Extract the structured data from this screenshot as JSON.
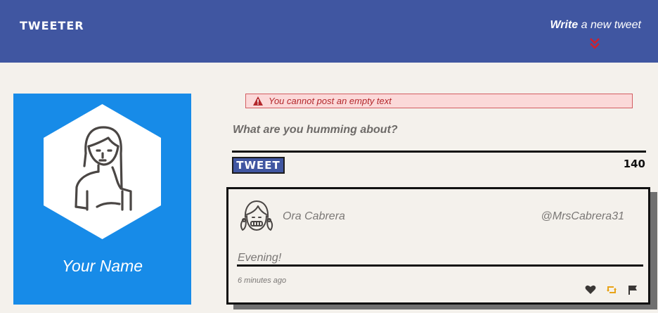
{
  "header": {
    "logo": "TWEETER",
    "compose_toggle_bold": "Write",
    "compose_toggle_rest": " a new tweet",
    "background_color": "#4056a1"
  },
  "profile": {
    "name": "Your Name",
    "background_color": "#178be8",
    "avatar_icon": "user-avatar-icon"
  },
  "compose": {
    "error_message": "You cannot post an empty text",
    "error_icon": "warning-triangle-icon",
    "placeholder": "What are you humming about?",
    "value": "",
    "submit_label": "TWEET",
    "char_count": "140"
  },
  "tweets": [
    {
      "author": "Ora Cabrera",
      "handle": "@MrsCabrera31",
      "text": "Evening!",
      "timestamp": "6 minutes ago",
      "actions": [
        "heart-icon",
        "retweet-icon",
        "flag-icon"
      ],
      "retweet_color": "#e8a317"
    }
  ]
}
